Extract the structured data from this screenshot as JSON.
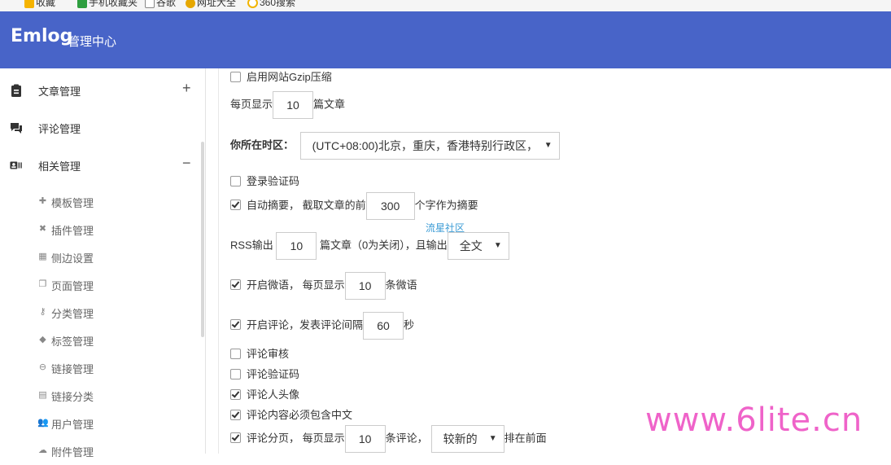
{
  "bookmarks": [
    {
      "label": "收藏",
      "icon": "star-icon",
      "color": "#f5b300"
    },
    {
      "label": "手机收藏夹",
      "icon": "phone-icon",
      "color": "#2e9e3f"
    },
    {
      "label": "谷歌",
      "icon": "page-icon",
      "color": "#888888"
    },
    {
      "label": "网址大全",
      "icon": "globe-icon",
      "color": "#e6a700"
    },
    {
      "label": "360搜索",
      "icon": "search-icon",
      "color": "#f2b400"
    }
  ],
  "header": {
    "logo": "Emlog",
    "subtitle": "管理中心",
    "color": "#4864c8"
  },
  "sidebar": {
    "main_items": [
      {
        "label": "文章管理",
        "icon": "clipboard-icon",
        "toggle": "+"
      },
      {
        "label": "评论管理",
        "icon": "comment-icon",
        "toggle": ""
      },
      {
        "label": "相关管理",
        "icon": "id-card-icon",
        "toggle": "−"
      }
    ],
    "sub_items": [
      {
        "label": "模板管理",
        "icon": "puzzle-icon"
      },
      {
        "label": "插件管理",
        "icon": "plug-icon"
      },
      {
        "label": "侧边设置",
        "icon": "grid-icon"
      },
      {
        "label": "页面管理",
        "icon": "page-icon"
      },
      {
        "label": "分类管理",
        "icon": "key-icon"
      },
      {
        "label": "标签管理",
        "icon": "tag-icon"
      },
      {
        "label": "链接管理",
        "icon": "link-icon"
      },
      {
        "label": "链接分类",
        "icon": "link-category-icon"
      },
      {
        "label": "用户管理",
        "icon": "users-icon"
      },
      {
        "label": "附件管理",
        "icon": "cloud-icon"
      }
    ]
  },
  "settings": {
    "gzip": {
      "checked": false,
      "label": "启用网站Gzip压缩"
    },
    "per_page": {
      "before": "每页显示",
      "value": "10",
      "after": "篇文章"
    },
    "timezone": {
      "label": "你所在时区：",
      "value": "(UTC+08:00)北京，重庆，香港特别行政区，"
    },
    "login_captcha": {
      "checked": false,
      "label": "登录验证码"
    },
    "auto_excerpt": {
      "checked": true,
      "before": "自动摘要， 截取文章的前",
      "value": "300",
      "after": "个字作为摘要"
    },
    "community_link": "流星社区",
    "rss": {
      "before": "RSS输出",
      "value": "10",
      "middle": "篇文章（0为关闭），且输出",
      "select": "全文"
    },
    "twitter": {
      "checked": true,
      "before": "开启微语， 每页显示",
      "value": "10",
      "after": "条微语"
    },
    "comments": {
      "checked": true,
      "before": "开启评论，发表评论间隔",
      "value": "60",
      "after": "秒"
    },
    "comment_review": {
      "checked": false,
      "label": "评论审核"
    },
    "comment_captcha": {
      "checked": false,
      "label": "评论验证码"
    },
    "comment_avatar": {
      "checked": true,
      "label": "评论人头像"
    },
    "comment_chinese": {
      "checked": true,
      "label": "评论内容必须包含中文"
    },
    "comment_paging": {
      "checked": true,
      "before": "评论分页， 每页显示",
      "value": "10",
      "middle": "条评论，",
      "select": "较新的",
      "after": "排在前面"
    }
  },
  "watermark": "www.6lite.cn"
}
